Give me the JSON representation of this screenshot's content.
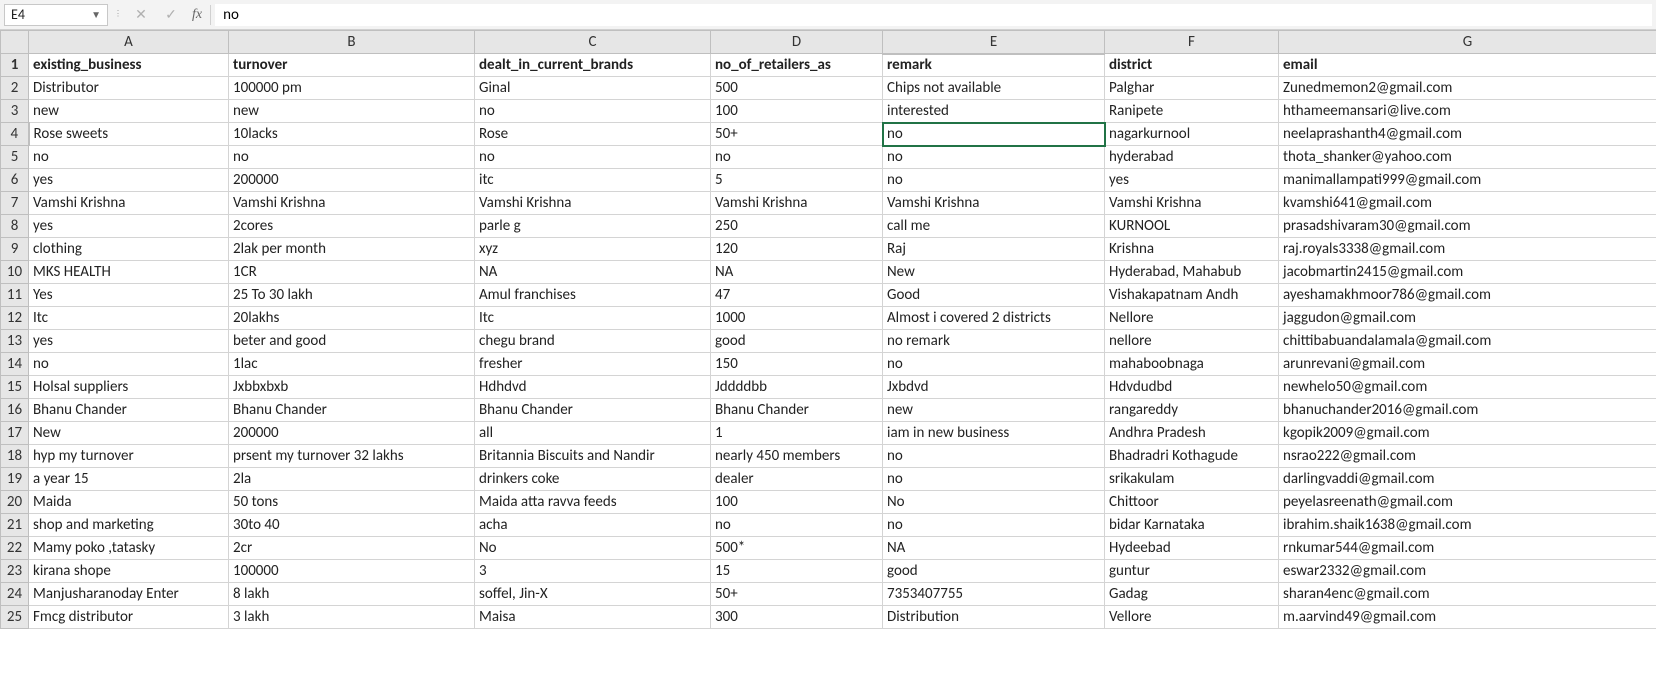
{
  "name_box": "E4",
  "formula_value": "no",
  "active": {
    "col": "E",
    "row": 4
  },
  "columns": [
    "A",
    "B",
    "C",
    "D",
    "E",
    "F",
    "G"
  ],
  "headers": {
    "A": "existing_business",
    "B": "turnover",
    "C": "dealt_in_current_brands",
    "D": "no_of_retailers_as",
    "E": "remark",
    "F": "district",
    "G": "email"
  },
  "rows": [
    {
      "n": 2,
      "A": "Distributor",
      "B": "100000 pm",
      "C": "Ginal",
      "D": "500",
      "E": "Chips not available",
      "F": "Palghar",
      "G": "Zunedmemon2@gmail.com"
    },
    {
      "n": 3,
      "A": "new",
      "B": "new",
      "C": "no",
      "D": "100",
      "E": "interested",
      "F": "Ranipete",
      "G": "hthameemansari@live.com"
    },
    {
      "n": 4,
      "A": "Rose sweets",
      "B": "10lacks",
      "C": "Rose",
      "D": "50+",
      "E": "no",
      "F": "nagarkurnool",
      "G": "neelaprashanth4@gmail.com"
    },
    {
      "n": 5,
      "A": "no",
      "B": "no",
      "C": "no",
      "D": "no",
      "E": "no",
      "F": "hyderabad",
      "G": "thota_shanker@yahoo.com"
    },
    {
      "n": 6,
      "A": "yes",
      "B": "200000",
      "C": "itc",
      "D": "5",
      "E": "no",
      "F": "yes",
      "G": "manimallampati999@gmail.com"
    },
    {
      "n": 7,
      "A": "Vamshi Krishna",
      "B": "Vamshi Krishna",
      "C": "Vamshi Krishna",
      "D": "Vamshi Krishna",
      "E": "Vamshi Krishna",
      "F": "Vamshi Krishna",
      "G": "kvamshi641@gmail.com"
    },
    {
      "n": 8,
      "A": "yes",
      "B": "2cores",
      "C": "parle g",
      "D": "250",
      "E": "call me",
      "F": "KURNOOL",
      "G": "prasadshivaram30@gmail.com"
    },
    {
      "n": 9,
      "A": "clothing",
      "B": "2lak per month",
      "C": "xyz",
      "D": "120",
      "E": "Raj",
      "F": "Krishna",
      "G": "raj.royals3338@gmail.com"
    },
    {
      "n": 10,
      "A": "MKS HEALTH",
      "B": "1CR",
      "C": "NA",
      "D": "NA",
      "E": "New",
      "F": "Hyderabad, Mahabub",
      "G": "jacobmartin2415@gmail.com"
    },
    {
      "n": 11,
      "A": "Yes",
      "B": "25 To 30 lakh",
      "C": "Amul franchises",
      "D": "47",
      "E": "Good",
      "F": "Vishakapatnam Andh",
      "G": "ayeshamakhmoor786@gmail.com"
    },
    {
      "n": 12,
      "A": "Itc",
      "B": "20lakhs",
      "C": "Itc",
      "D": "1000",
      "E": "Almost i covered 2 districts",
      "F": "Nellore",
      "G": "jaggudon@gmail.com"
    },
    {
      "n": 13,
      "A": "yes",
      "B": "beter and good",
      "C": "chegu brand",
      "D": "good",
      "E": "no remark",
      "F": "nellore",
      "G": "chittibabuandalamala@gmail.com"
    },
    {
      "n": 14,
      "A": "no",
      "B": "1lac",
      "C": "fresher",
      "D": "150",
      "E": "no",
      "F": "mahaboobnaga",
      "G": "arunrevani@gmail.com"
    },
    {
      "n": 15,
      "A": "Holsal suppliers",
      "B": "Jxbbxbxb",
      "C": "Hdhdvd",
      "D": "Jddddbb",
      "E": "Jxbdvd",
      "F": "Hdvdudbd",
      "G": "newhelo50@gmail.com"
    },
    {
      "n": 16,
      "A": "Bhanu Chander",
      "B": "Bhanu Chander",
      "C": "Bhanu Chander",
      "D": "Bhanu Chander",
      "E": "new",
      "F": "rangareddy",
      "G": "bhanuchander2016@gmail.com"
    },
    {
      "n": 17,
      "A": "New",
      "B": "200000",
      "C": "all",
      "D": "1",
      "E": "iam in new business",
      "F": "Andhra Pradesh",
      "G": "kgopik2009@gmail.com"
    },
    {
      "n": 18,
      "A": "hyp my turnover",
      "B": "prsent my turnover 32 lakhs",
      "C": "Britannia Biscuits and Nandir",
      "D": "nearly 450 members",
      "E": "no",
      "F": "Bhadradri Kothagude",
      "G": "nsrao222@gmail.com"
    },
    {
      "n": 19,
      "A": "a year 15",
      "B": "2la",
      "C": "drinkers coke",
      "D": "dealer",
      "E": "no",
      "F": "srikakulam",
      "G": "darlingvaddi@gmail.com"
    },
    {
      "n": 20,
      "A": "Maida",
      "B": "50 tons",
      "C": "Maida atta ravva feeds",
      "D": "100",
      "E": "No",
      "F": "Chittoor",
      "G": "peyelasreenath@gmail.com"
    },
    {
      "n": 21,
      "A": "shop and marketing",
      "B": "30to 40",
      "C": "acha",
      "D": "no",
      "E": "no",
      "F": "bidar Karnataka",
      "G": "ibrahim.shaik1638@gmail.com"
    },
    {
      "n": 22,
      "A": "Mamy poko ,tatasky",
      "B": "2cr",
      "C": "No",
      "D": "500*",
      "E": "NA",
      "F": "Hydeebad",
      "G": "rnkumar544@gmail.com"
    },
    {
      "n": 23,
      "A": "kirana shope",
      "B": "100000",
      "C": "3",
      "D": "15",
      "E": "good",
      "F": "guntur",
      "G": "eswar2332@gmail.com"
    },
    {
      "n": 24,
      "A": "Manjusharanoday Enter",
      "B": "8 lakh",
      "C": "soffel, Jin-X",
      "D": "50+",
      "E": "7353407755",
      "F": "Gadag",
      "G": "sharan4enc@gmail.com"
    },
    {
      "n": 25,
      "A": "Fmcg distributor",
      "B": "3 lakh",
      "C": "Maisa",
      "D": "300",
      "E": "Distribution",
      "F": "Vellore",
      "G": "m.aarvind49@gmail.com"
    }
  ]
}
